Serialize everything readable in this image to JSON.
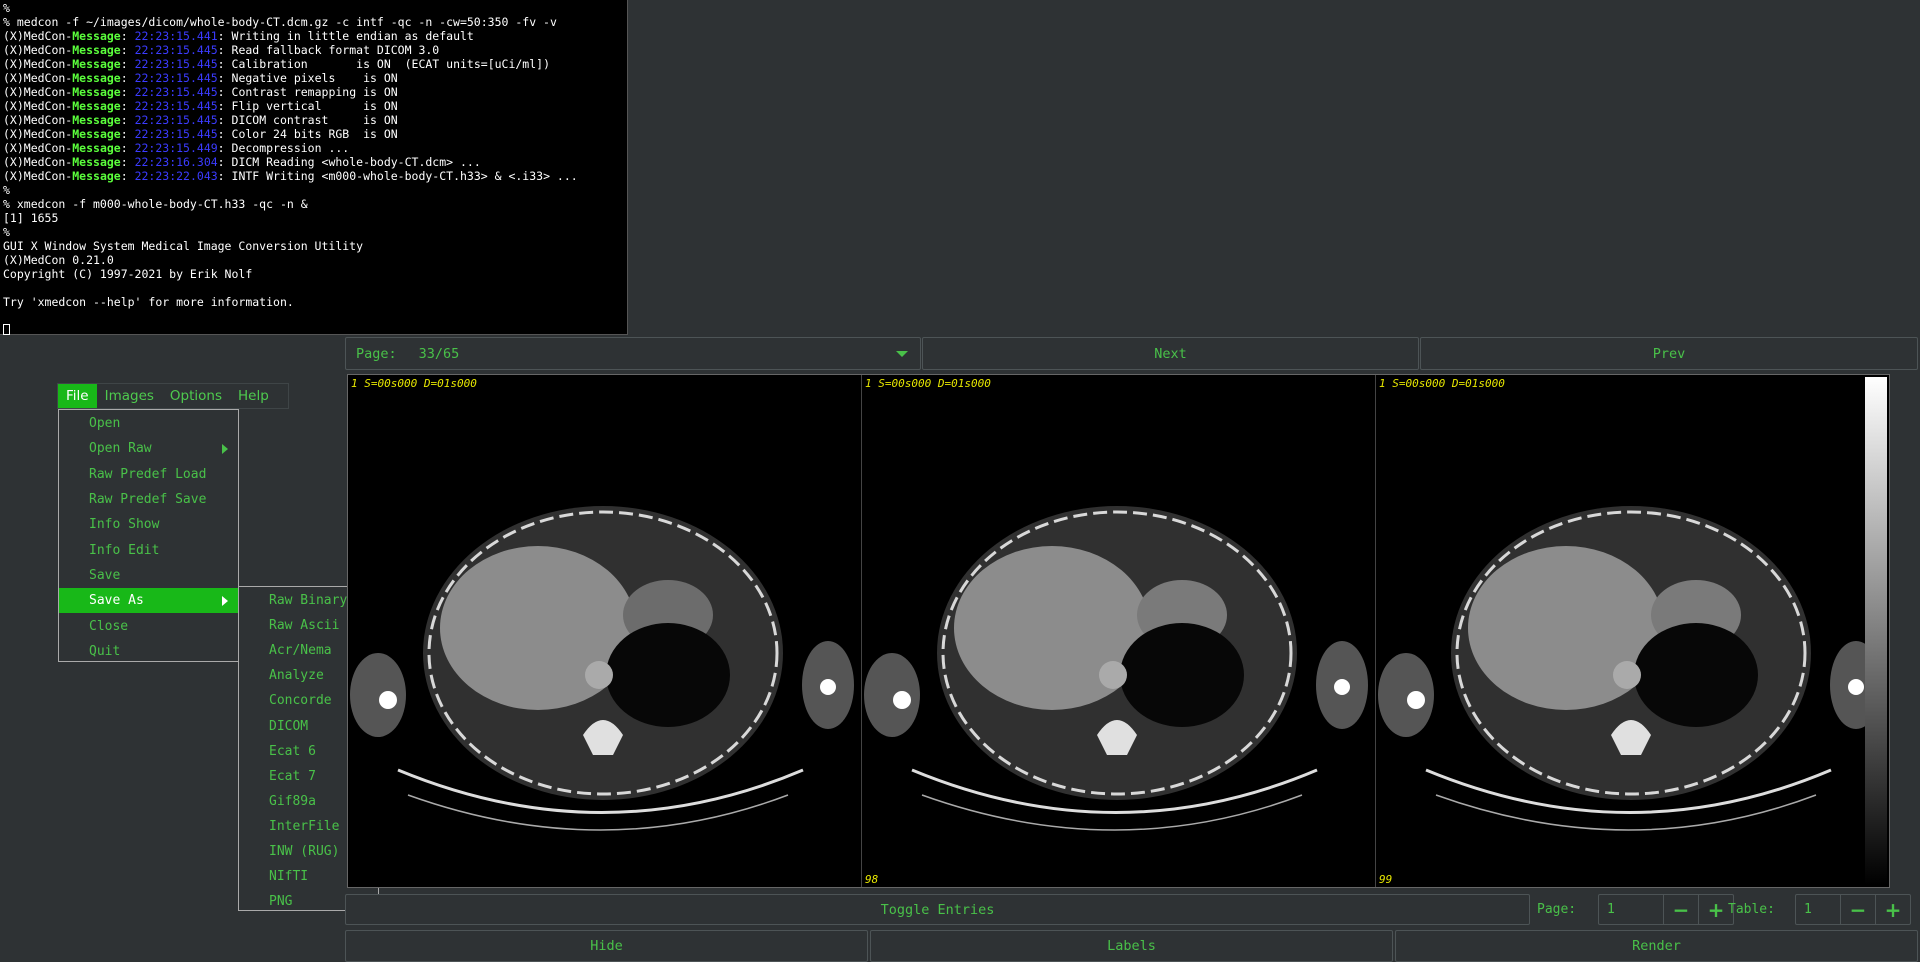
{
  "terminal": {
    "lines": [
      {
        "t": "%"
      },
      {
        "t": "% medcon -f ~/images/dicom/whole-body-CT.dcm.gz -c intf -qc -n -cw=50:350 -fv -v"
      },
      {
        "p": "(X)MedCon-",
        "hl": "Message",
        "s": ": ",
        "ts": "22:23:15.441",
        "r": ": Writing in little endian as default"
      },
      {
        "p": "(X)MedCon-",
        "hl": "Message",
        "s": ": ",
        "ts": "22:23:15.445",
        "r": ": Read fallback format DICOM 3.0"
      },
      {
        "p": "(X)MedCon-",
        "hl": "Message",
        "s": ": ",
        "ts": "22:23:15.445",
        "r": ": Calibration       is ON  (ECAT units=[uCi/ml])"
      },
      {
        "p": "(X)MedCon-",
        "hl": "Message",
        "s": ": ",
        "ts": "22:23:15.445",
        "r": ": Negative pixels    is ON"
      },
      {
        "p": "(X)MedCon-",
        "hl": "Message",
        "s": ": ",
        "ts": "22:23:15.445",
        "r": ": Contrast remapping is ON"
      },
      {
        "p": "(X)MedCon-",
        "hl": "Message",
        "s": ": ",
        "ts": "22:23:15.445",
        "r": ": Flip vertical      is ON"
      },
      {
        "p": "(X)MedCon-",
        "hl": "Message",
        "s": ": ",
        "ts": "22:23:15.445",
        "r": ": DICOM contrast     is ON"
      },
      {
        "p": "(X)MedCon-",
        "hl": "Message",
        "s": ": ",
        "ts": "22:23:15.445",
        "r": ": Color 24 bits RGB  is ON"
      },
      {
        "p": "(X)MedCon-",
        "hl": "Message",
        "s": ": ",
        "ts": "22:23:15.449",
        "r": ": Decompression ..."
      },
      {
        "p": "(X)MedCon-",
        "hl": "Message",
        "s": ": ",
        "ts": "22:23:16.304",
        "r": ": DICM Reading <whole-body-CT.dcm> ..."
      },
      {
        "p": "(X)MedCon-",
        "hl": "Message",
        "s": ": ",
        "ts": "22:23:22.043",
        "r": ": INTF Writing <m000-whole-body-CT.h33> & <.i33> ..."
      },
      {
        "t": "%"
      },
      {
        "t": "% xmedcon -f m000-whole-body-CT.h33 -qc -n &"
      },
      {
        "t": "[1] 1655"
      },
      {
        "t": "%"
      },
      {
        "t": "GUI X Window System Medical Image Conversion Utility"
      },
      {
        "t": "(X)MedCon 0.21.0"
      },
      {
        "t": "Copyright (C) 1997-2021 by Erik Nolf"
      },
      {
        "t": ""
      },
      {
        "t": "Try 'xmedcon --help' for more information."
      }
    ]
  },
  "menubar": [
    "File",
    "Images",
    "Options",
    "Help"
  ],
  "file_menu": [
    {
      "label": "Open"
    },
    {
      "label": "Open Raw",
      "submenu": true
    },
    {
      "label": "Raw Predef Load"
    },
    {
      "label": "Raw Predef Save"
    },
    {
      "label": "Info Show"
    },
    {
      "label": "Info Edit"
    },
    {
      "label": "Save"
    },
    {
      "label": "Save As",
      "submenu": true,
      "active": true
    },
    {
      "label": "Close"
    },
    {
      "label": "Quit"
    }
  ],
  "save_as_menu": [
    "Raw Binary",
    "Raw Ascii",
    "Acr/Nema",
    "Analyze",
    "Concorde",
    "DICOM",
    "Ecat 6",
    "Ecat 7",
    "Gif89a",
    "InterFile",
    "INW (RUG)",
    "NIfTI",
    "PNG"
  ],
  "viewer": {
    "page_label": "Page:",
    "page_value": "33/65",
    "next_label": "Next",
    "prev_label": "Prev",
    "panels": [
      {
        "label": "1 S=00s000 D=01s000",
        "number": ""
      },
      {
        "label": "1 S=00s000 D=01s000",
        "number": "98"
      },
      {
        "label": "1 S=00s000 D=01s000",
        "number": "99"
      }
    ],
    "toggle_entries_label": "Toggle Entries",
    "page_spin_label": "Page:",
    "page_spin_value": "1",
    "table_spin_label": "Table:",
    "table_spin_value": "1",
    "hide_label": "Hide",
    "labels_label": "Labels",
    "render_label": "Render"
  }
}
